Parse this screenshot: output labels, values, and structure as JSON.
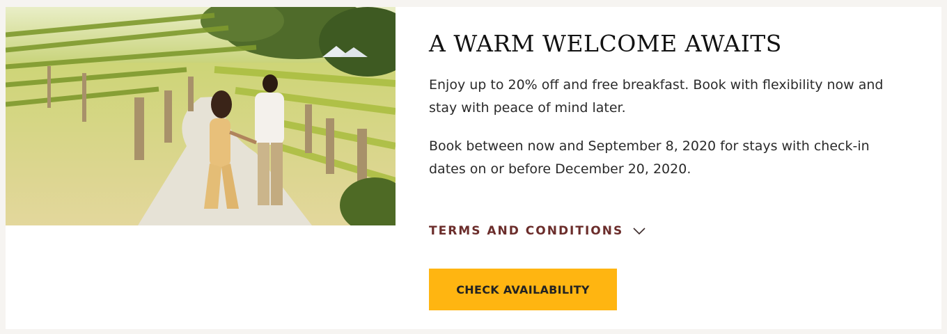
{
  "promo": {
    "image_alt": "Couple walking hand in hand through a vineyard",
    "title": "A WARM WELCOME AWAITS",
    "paragraph_1": "Enjoy up to 20% off and free breakfast. Book with flexibility now and stay with peace of mind later.",
    "paragraph_2": "Book between now and September 8, 2020 for stays with check-in dates on or before December 20, 2020.",
    "terms_label": "TERMS AND CONDITIONS",
    "terms_icon": "chevron-down-icon",
    "cta_label": "CHECK AVAILABILITY"
  },
  "colors": {
    "page_background": "#f6f4f1",
    "card_background": "#ffffff",
    "title_text": "#111111",
    "terms_text": "#6b2d2b",
    "cta_background": "#ffb511",
    "cta_text": "#222222"
  }
}
